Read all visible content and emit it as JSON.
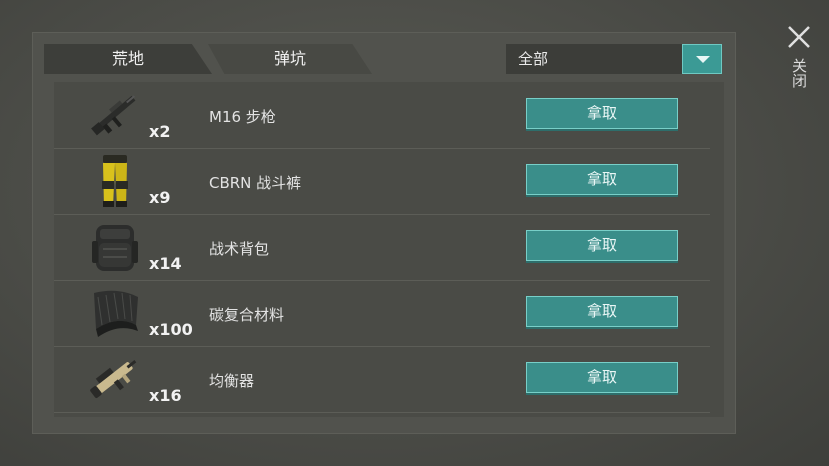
{
  "tabs": [
    {
      "label": "荒地"
    },
    {
      "label": "弹坑"
    }
  ],
  "filter": {
    "selected": "全部"
  },
  "close": {
    "label": "关闭"
  },
  "items": [
    {
      "name": "M16 步枪",
      "qty": "x2",
      "action": "拿取",
      "icon": "rifle-icon"
    },
    {
      "name": "CBRN 战斗裤",
      "qty": "x9",
      "action": "拿取",
      "icon": "pants-icon"
    },
    {
      "name": "战术背包",
      "qty": "x14",
      "action": "拿取",
      "icon": "backpack-icon"
    },
    {
      "name": "碳复合材料",
      "qty": "x100",
      "action": "拿取",
      "icon": "carbon-sheet-icon"
    },
    {
      "name": "均衡器",
      "qty": "x16",
      "action": "拿取",
      "icon": "gun-icon"
    }
  ],
  "colors": {
    "accent": "#3a8e8a",
    "accent_border": "#78cfc8"
  }
}
